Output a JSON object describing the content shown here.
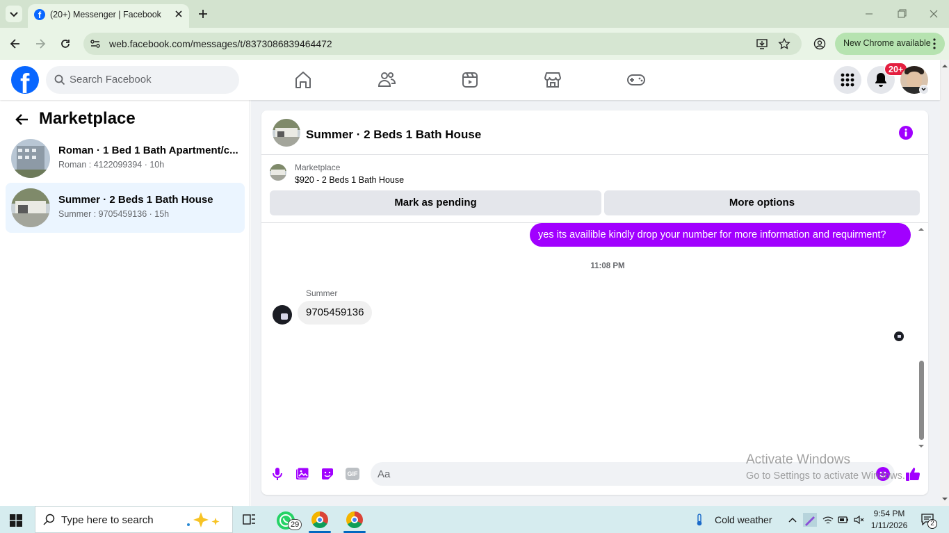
{
  "browser": {
    "tab_title": "(20+) Messenger | Facebook",
    "url": "web.facebook.com/messages/t/8373086839464472",
    "chrome_update_label": "New Chrome available"
  },
  "fb_header": {
    "search_placeholder": "Search Facebook",
    "notification_badge": "20+"
  },
  "sidebar": {
    "title": "Marketplace",
    "conversations": [
      {
        "title": "Roman · 1 Bed 1 Bath Apartment/c...",
        "subtitle": "Roman : 4122099394 · 10h",
        "selected": false
      },
      {
        "title": "Summer · 2 Beds 1 Bath House",
        "subtitle": "Summer : 9705459136 · 15h",
        "selected": true
      }
    ]
  },
  "chat": {
    "header_title": "Summer · 2 Beds 1 Bath House",
    "listing_label": "Marketplace",
    "listing_detail": "$920 - 2 Beds 1 Bath House",
    "mark_pending_label": "Mark as pending",
    "more_options_label": "More options",
    "messages": [
      {
        "from": "me",
        "text": "yes its availible kindly drop your number for more information and requirment?"
      },
      {
        "type": "timestamp",
        "text": "11:08 PM"
      },
      {
        "from": "Summer",
        "sender_label": "Summer",
        "text": "9705459136"
      }
    ],
    "composer_placeholder": "Aa",
    "accent_color": "#a100ff"
  },
  "watermark": {
    "line1": "Activate Windows",
    "line2": "Go to Settings to activate Windows."
  },
  "taskbar": {
    "search_placeholder": "Type here to search",
    "whatsapp_badge": "29",
    "weather": "Cold weather",
    "time": "9:54 PM",
    "date": "1/11/2026",
    "notifications_count": "2"
  }
}
